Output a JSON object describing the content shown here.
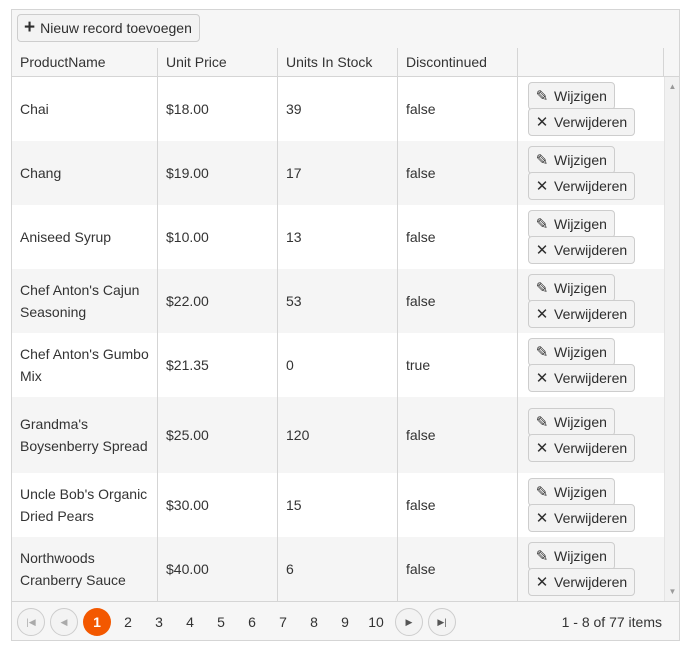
{
  "toolbar": {
    "add_label": "Nieuw record toevoegen",
    "add_icon": "plus-icon"
  },
  "columns": [
    "ProductName",
    "Unit Price",
    "Units In Stock",
    "Discontinued",
    ""
  ],
  "rows": [
    {
      "name": "Chai",
      "price": "$18.00",
      "stock": "39",
      "disc": "false"
    },
    {
      "name": "Chang",
      "price": "$19.00",
      "stock": "17",
      "disc": "false"
    },
    {
      "name": "Aniseed Syrup",
      "price": "$10.00",
      "stock": "13",
      "disc": "false"
    },
    {
      "name": "Chef Anton's Cajun Seasoning",
      "price": "$22.00",
      "stock": "53",
      "disc": "false"
    },
    {
      "name": "Chef Anton's Gumbo Mix",
      "price": "$21.35",
      "stock": "0",
      "disc": "true"
    },
    {
      "name": "Grandma's Boysenberry Spread",
      "price": "$25.00",
      "stock": "120",
      "disc": "false"
    },
    {
      "name": "Uncle Bob's Organic Dried Pears",
      "price": "$30.00",
      "stock": "15",
      "disc": "false"
    },
    {
      "name": "Northwoods Cranberry Sauce",
      "price": "$40.00",
      "stock": "6",
      "disc": "false"
    }
  ],
  "commands": {
    "edit_label": "Wijzigen",
    "delete_label": "Verwijderen",
    "edit_icon": "pencil-icon",
    "delete_icon": "x-icon"
  },
  "pager": {
    "pages": [
      "1",
      "2",
      "3",
      "4",
      "5",
      "6",
      "7",
      "8",
      "9",
      "10"
    ],
    "current": "1",
    "info": "1 - 8 of 77 items"
  },
  "colors": {
    "accent": "#f35800",
    "alt_row": "#f5f5f5",
    "border": "#d5d5d5"
  }
}
